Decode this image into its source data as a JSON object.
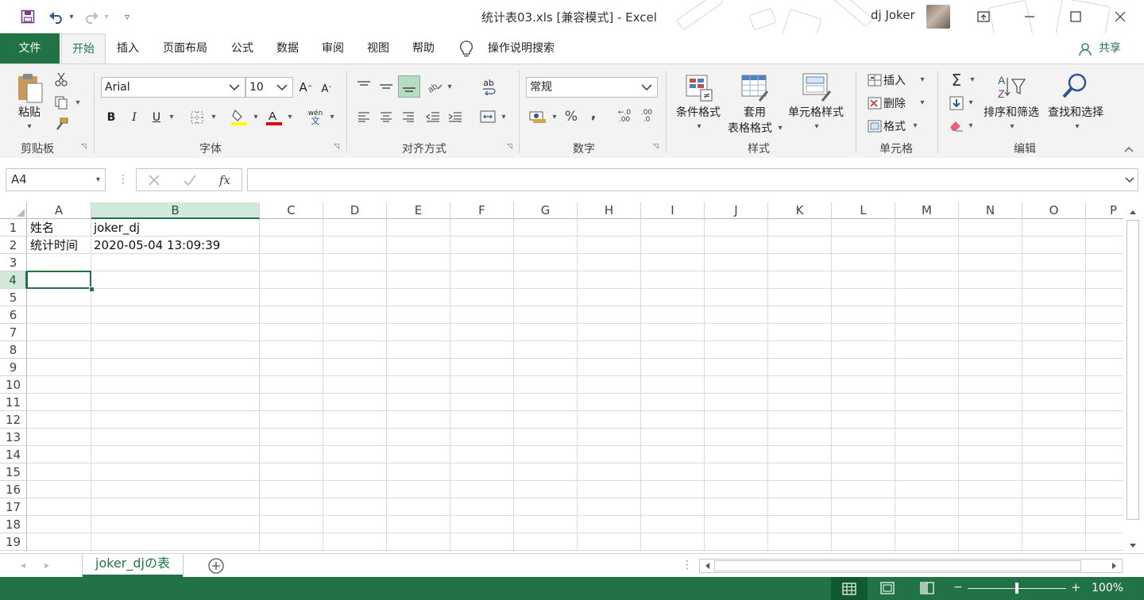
{
  "window": {
    "title": "统计表03.xls  [兼容模式]  -  Excel",
    "user_name": "dj Joker",
    "qat": {
      "save": "save-icon",
      "undo": "undo-icon",
      "redo": "redo-icon",
      "customize": "customize-icon"
    }
  },
  "tabs": [
    "文件",
    "开始",
    "插入",
    "页面布局",
    "公式",
    "数据",
    "审阅",
    "视图",
    "帮助"
  ],
  "tell_me": "操作说明搜索",
  "share": "共享",
  "ribbon": {
    "clipboard": {
      "label": "剪贴板",
      "paste": "粘贴"
    },
    "font": {
      "label": "字体",
      "font_name": "Arial",
      "font_size": "10",
      "bold": "B",
      "italic": "I",
      "underline": "U",
      "phonetic": "wén"
    },
    "alignment": {
      "label": "对齐方式",
      "wrap": "ab"
    },
    "number": {
      "label": "数字",
      "format": "常规",
      "percent": "%",
      "comma": ",",
      "inc_dec": ".00",
      "dec_dec": ".0"
    },
    "styles": {
      "label": "样式",
      "conditional": "条件格式",
      "table_line1": "套用",
      "table_line2": "表格格式",
      "cell_styles": "单元格样式"
    },
    "cells": {
      "label": "单元格",
      "insert": "插入",
      "delete": "删除",
      "format": "格式"
    },
    "editing": {
      "label": "编辑",
      "sort": "排序和筛选",
      "find": "查找和选择",
      "sigma": "Σ"
    }
  },
  "formula_bar": {
    "name_box": "A4",
    "fx": "fx",
    "content": ""
  },
  "grid": {
    "columns": [
      "A",
      "B",
      "C",
      "D",
      "E",
      "F",
      "G",
      "H",
      "I",
      "J",
      "K",
      "L",
      "M",
      "N",
      "O",
      "P"
    ],
    "rows": [
      "1",
      "2",
      "3",
      "4",
      "5",
      "6",
      "7",
      "8",
      "9",
      "10",
      "11",
      "12",
      "13",
      "14",
      "15",
      "16",
      "17",
      "18",
      "19"
    ],
    "cells": {
      "A1": "姓名",
      "B1": "joker_dj",
      "A2": "统计时间",
      "B2": "2020-05-04 13:09:39"
    },
    "active_cell": "A4",
    "selected_column": "B"
  },
  "sheet_tabs": [
    {
      "name": "joker_djの表",
      "active": true
    }
  ],
  "status": {
    "zoom": "100%"
  },
  "colors": {
    "accent": "#217346",
    "selected_header": "#b7dbc3"
  }
}
